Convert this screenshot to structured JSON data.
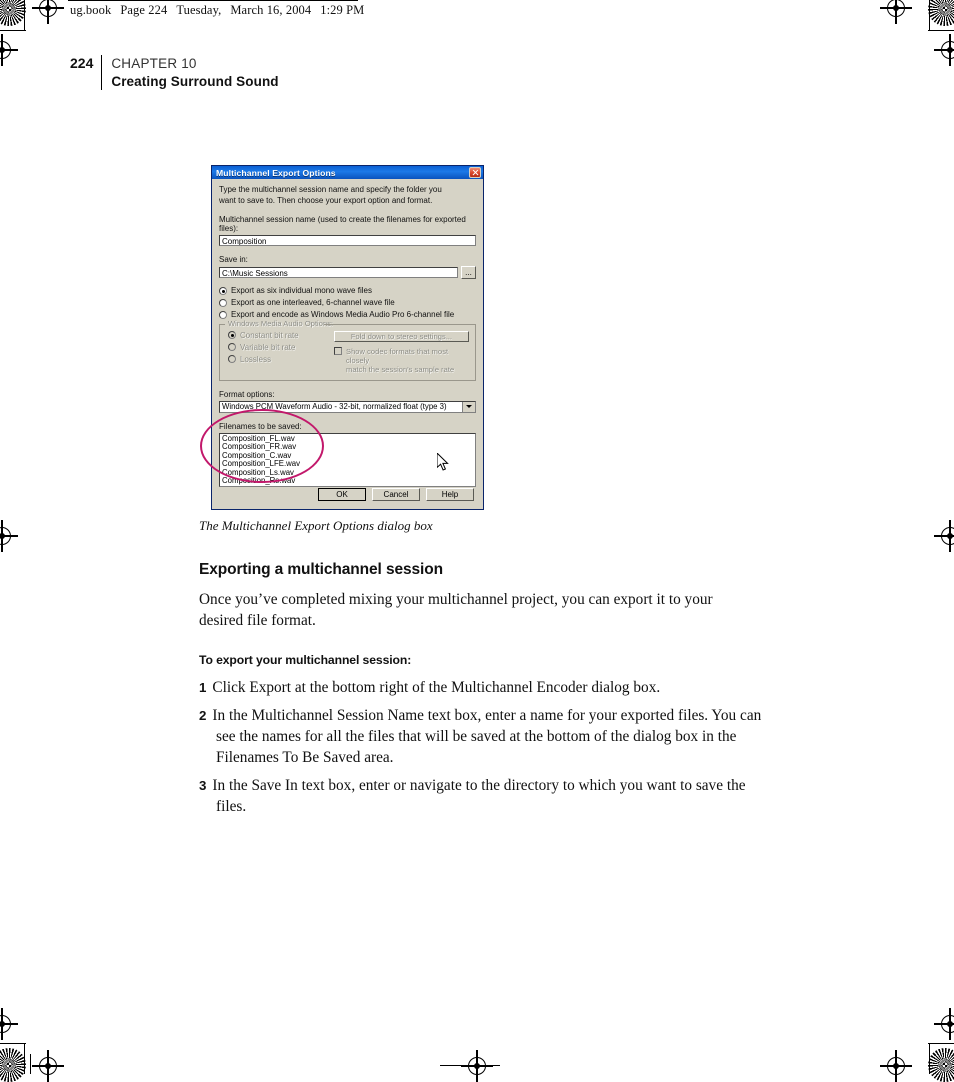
{
  "header": {
    "filename": "ug.book",
    "page_label": "Page 224",
    "weekday": "Tuesday,",
    "date": "March 16, 2004",
    "time": "1:29 PM"
  },
  "chapter": {
    "page_number": "224",
    "chapter_label": "CHAPTER 10",
    "chapter_title": "Creating Surround Sound"
  },
  "dialog": {
    "title": "Multichannel Export Options",
    "close_label": "×",
    "intro_line1": "Type the multichannel session name and specify the folder you",
    "intro_line2": "want to save to.   Then choose your export option and format.",
    "session_name_label": "Multichannel session name (used to create the filenames for exported files):",
    "session_name_value": "Composition",
    "save_in_label": "Save in:",
    "save_in_value": "C:\\Music Sessions",
    "browse_label": "...",
    "export_options": [
      {
        "label": "Export as six individual mono wave files",
        "selected": true,
        "disabled": false
      },
      {
        "label": "Export as one interleaved, 6-channel wave file",
        "selected": false,
        "disabled": false
      },
      {
        "label": "Export and encode as Windows Media Audio Pro 6-channel file",
        "selected": false,
        "disabled": false
      }
    ],
    "wma_group": {
      "legend": "Windows Media Audio Options:",
      "bitrate_options": [
        {
          "label": "Constant bit rate",
          "selected": true
        },
        {
          "label": "Variable bit rate",
          "selected": false
        },
        {
          "label": "Lossless",
          "selected": false
        }
      ],
      "fold_down_button": "Fold down to stereo settings...",
      "checkbox_line1": "Show codec formats that most closely",
      "checkbox_line2": "match the session's sample rate",
      "checked": false
    },
    "format_label": "Format options:",
    "format_value": "Windows PCM Waveform Audio - 32-bit, normalized float (type 3)",
    "filenames_label": "Filenames to be saved:",
    "filenames": [
      "Composition_FL.wav",
      "Composition_FR.wav",
      "Composition_C.wav",
      "Composition_LFE.wav",
      "Composition_Ls.wav",
      "Composition_Rs.wav"
    ],
    "buttons": {
      "ok": "OK",
      "cancel": "Cancel",
      "help": "Help"
    }
  },
  "figure_caption": "The Multichannel Export Options dialog box",
  "section": {
    "heading": "Exporting a multichannel session",
    "intro": "Once you’ve completed mixing your multichannel project, you can export it to your desired file format.",
    "procedure_title": "To export your multichannel session:",
    "steps": [
      {
        "number": "1",
        "text": "Click Export at the bottom right of the Multichannel Encoder dialog box."
      },
      {
        "number": "2",
        "text": "In the Multichannel Session Name text box, enter a name for your exported files. You can see the names for all the files that will be saved at the bottom of the dialog box in the Filenames To Be Saved area."
      },
      {
        "number": "3",
        "text": "In the Save In text box, enter or navigate to the directory to which you want to save the files."
      }
    ]
  },
  "annotation": {
    "highlight_color": "#c2186b",
    "shape": "ellipse",
    "target": "Filenames to be saved list"
  }
}
